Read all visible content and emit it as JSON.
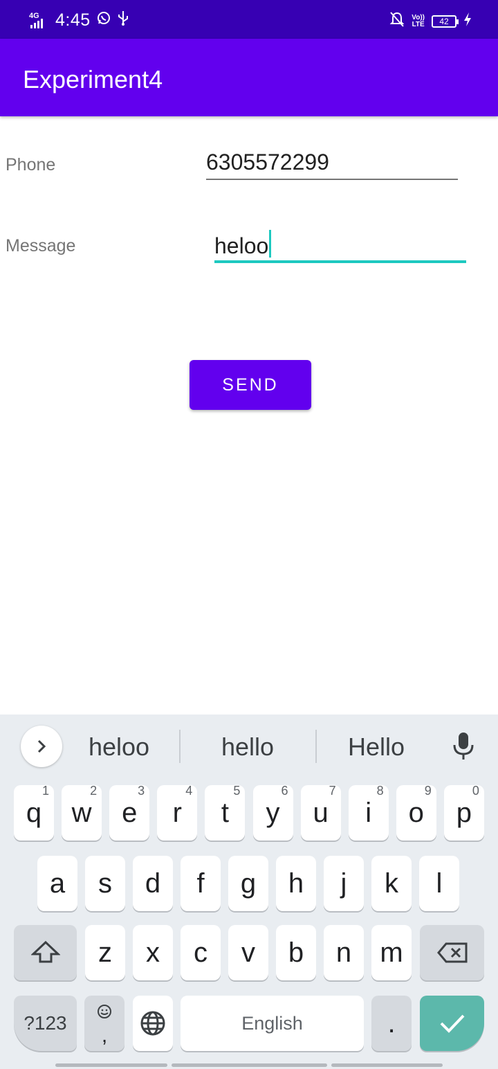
{
  "status_bar": {
    "network": "4G",
    "time": "4:45",
    "volte_top": "Vo))",
    "volte_bottom": "LTE",
    "battery": "42"
  },
  "app_bar": {
    "title": "Experiment4"
  },
  "form": {
    "phone_label": "Phone",
    "phone_value": "6305572299",
    "message_label": "Message",
    "message_value": "heloo",
    "send_label": "SEND"
  },
  "keyboard": {
    "suggestions": [
      "heloo",
      "hello",
      "Hello"
    ],
    "row1": [
      {
        "key": "q",
        "hint": "1"
      },
      {
        "key": "w",
        "hint": "2"
      },
      {
        "key": "e",
        "hint": "3"
      },
      {
        "key": "r",
        "hint": "4"
      },
      {
        "key": "t",
        "hint": "5"
      },
      {
        "key": "y",
        "hint": "6"
      },
      {
        "key": "u",
        "hint": "7"
      },
      {
        "key": "i",
        "hint": "8"
      },
      {
        "key": "o",
        "hint": "9"
      },
      {
        "key": "p",
        "hint": "0"
      }
    ],
    "row2": [
      "a",
      "s",
      "d",
      "f",
      "g",
      "h",
      "j",
      "k",
      "l"
    ],
    "row3": [
      "z",
      "x",
      "c",
      "v",
      "b",
      "n",
      "m"
    ],
    "symbols_label": "?123",
    "comma_label": ",",
    "space_label": "English",
    "period_label": ".",
    "colors": {
      "action": "#5cb8ab",
      "accent": "#6200ee",
      "focus": "#1ec9c0"
    }
  }
}
